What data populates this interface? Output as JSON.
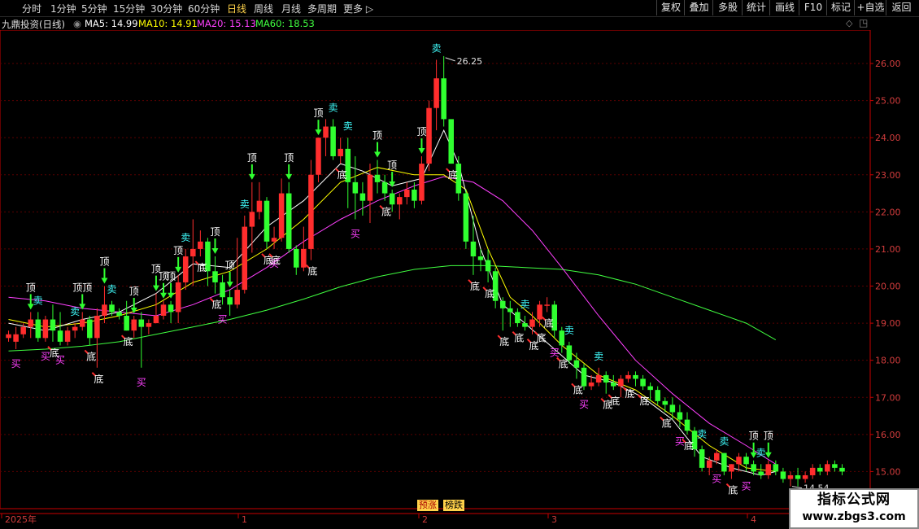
{
  "toolbar": {
    "periods": [
      "分时",
      "1分钟",
      "5分钟",
      "15分钟",
      "30分钟",
      "60分钟",
      "日线",
      "周线",
      "月线",
      "多周期",
      "更多 ▷"
    ],
    "active": "日线",
    "right_buttons": [
      "复权",
      "叠加",
      "多股",
      "统计",
      "画线",
      "F10",
      "标记",
      "+自选",
      "返回"
    ]
  },
  "legend": {
    "name": "九鼎投资(日线)",
    "ma5": "MA5: 14.99",
    "ma10": "MA10: 14.91",
    "ma20": "MA20: 15.13",
    "ma60": "MA60: 18.53"
  },
  "colors": {
    "up": "#ff2d2d",
    "down": "#30ff30",
    "ma5": "#ffffff",
    "ma10": "#ffff00",
    "ma20": "#ff40ff",
    "ma60": "#40ff40",
    "grid": "#5a0000",
    "axis": "#c80000",
    "sell": "#40ffff",
    "buy": "#ff40ff",
    "dtext": "#ffffff"
  },
  "badges": {
    "b1": "预涨",
    "b2": "榜跌"
  },
  "watermark": {
    "line1": "指标公式网",
    "line2": "www.zbgs3.com"
  },
  "chart_data": {
    "type": "candlestick",
    "ylim": [
      14.0,
      26.9
    ],
    "y_ticks": [
      "15.00",
      "16.00",
      "17.00",
      "18.00",
      "19.00",
      "20.00",
      "21.00",
      "22.00",
      "23.00",
      "24.00",
      "25.00",
      "26.00"
    ],
    "x_labels": [
      "2025年",
      "1",
      "2",
      "3",
      "4"
    ],
    "high_label": "26.25",
    "low_label": "14.54",
    "candles": [
      [
        18.6,
        18.7,
        18.5,
        18.8
      ],
      [
        18.5,
        18.7,
        18.3,
        18.9
      ],
      [
        18.7,
        18.9,
        18.6,
        19.0
      ],
      [
        18.9,
        19.1,
        18.6,
        19.3
      ],
      [
        19.1,
        18.6,
        18.5,
        19.3
      ],
      [
        18.6,
        19.1,
        18.5,
        19.2
      ],
      [
        19.1,
        18.8,
        18.5,
        19.5
      ],
      [
        18.8,
        18.5,
        18.4,
        19.3
      ],
      [
        18.5,
        18.8,
        18.4,
        18.9
      ],
      [
        18.8,
        18.9,
        18.6,
        19.0
      ],
      [
        18.9,
        19.1,
        18.8,
        19.3
      ],
      [
        19.1,
        18.6,
        18.4,
        19.2
      ],
      [
        18.6,
        19.2,
        17.8,
        19.4
      ],
      [
        19.2,
        19.5,
        19.0,
        20.0
      ],
      [
        19.5,
        19.3,
        19.2,
        19.6
      ],
      [
        19.3,
        19.2,
        19.1,
        19.4
      ],
      [
        19.2,
        18.8,
        18.8,
        19.6
      ],
      [
        18.8,
        19.1,
        18.6,
        19.2
      ],
      [
        19.1,
        18.9,
        17.8,
        19.3
      ],
      [
        18.9,
        19.0,
        18.7,
        19.1
      ],
      [
        19.0,
        19.2,
        19.0,
        19.8
      ],
      [
        19.2,
        19.5,
        19.1,
        19.6
      ],
      [
        19.5,
        19.3,
        19.0,
        19.6
      ],
      [
        19.3,
        20.1,
        19.0,
        20.3
      ],
      [
        20.1,
        20.8,
        19.9,
        21.0
      ],
      [
        20.8,
        21.0,
        20.0,
        21.8
      ],
      [
        21.0,
        21.2,
        20.8,
        21.5
      ],
      [
        21.2,
        20.4,
        20.0,
        21.3
      ],
      [
        20.4,
        20.1,
        19.8,
        20.8
      ],
      [
        20.1,
        19.7,
        19.5,
        20.3
      ],
      [
        19.7,
        19.5,
        19.2,
        19.9
      ],
      [
        19.5,
        19.9,
        19.4,
        21.3
      ],
      [
        19.9,
        21.6,
        19.8,
        21.9
      ],
      [
        21.6,
        22.0,
        20.9,
        22.8
      ],
      [
        22.0,
        22.3,
        21.8,
        22.8
      ],
      [
        22.3,
        21.2,
        21.0,
        22.4
      ],
      [
        21.2,
        21.3,
        21.0,
        21.6
      ],
      [
        21.3,
        22.5,
        21.2,
        22.9
      ],
      [
        22.5,
        21.0,
        20.9,
        22.8
      ],
      [
        21.0,
        20.5,
        20.3,
        21.1
      ],
      [
        20.5,
        21.0,
        20.4,
        21.6
      ],
      [
        21.0,
        23.0,
        20.7,
        23.4
      ],
      [
        23.0,
        24.0,
        22.8,
        24.0
      ],
      [
        24.0,
        24.3,
        23.5,
        24.5
      ],
      [
        24.3,
        23.5,
        23.4,
        24.5
      ],
      [
        23.5,
        23.7,
        23.3,
        24.0
      ],
      [
        23.7,
        22.8,
        22.1,
        24.0
      ],
      [
        22.8,
        22.5,
        21.8,
        23.5
      ],
      [
        22.5,
        22.3,
        21.9,
        22.8
      ],
      [
        22.3,
        23.0,
        21.7,
        23.3
      ],
      [
        23.0,
        22.8,
        22.5,
        23.4
      ],
      [
        22.8,
        22.5,
        22.3,
        23.0
      ],
      [
        22.5,
        22.2,
        22.0,
        22.6
      ],
      [
        22.2,
        22.4,
        21.8,
        22.5
      ],
      [
        22.4,
        22.6,
        22.2,
        22.8
      ],
      [
        22.6,
        22.3,
        22.1,
        22.8
      ],
      [
        22.3,
        23.3,
        22.2,
        23.5
      ],
      [
        23.3,
        24.8,
        23.1,
        25.0
      ],
      [
        24.8,
        25.6,
        24.2,
        26.1
      ],
      [
        25.6,
        24.5,
        24.3,
        26.2
      ],
      [
        24.5,
        23.3,
        23.3,
        24.0
      ],
      [
        23.3,
        22.5,
        22.3,
        23.5
      ],
      [
        22.5,
        21.2,
        21.0,
        22.6
      ],
      [
        21.2,
        20.8,
        20.3,
        21.9
      ],
      [
        20.8,
        20.7,
        20.4,
        21.0
      ],
      [
        20.7,
        20.4,
        20.1,
        21.0
      ],
      [
        20.4,
        19.6,
        19.4,
        20.5
      ],
      [
        19.6,
        19.4,
        18.8,
        19.7
      ],
      [
        19.4,
        19.3,
        18.9,
        19.6
      ],
      [
        19.3,
        19.0,
        18.9,
        19.4
      ],
      [
        19.0,
        18.9,
        18.8,
        19.2
      ],
      [
        18.9,
        19.1,
        18.7,
        19.3
      ],
      [
        19.1,
        19.5,
        18.9,
        19.6
      ],
      [
        19.5,
        19.5,
        19.3,
        19.7
      ],
      [
        19.5,
        18.8,
        18.6,
        19.6
      ],
      [
        18.8,
        18.4,
        18.2,
        18.9
      ],
      [
        18.4,
        18.0,
        17.9,
        18.5
      ],
      [
        18.0,
        17.8,
        17.5,
        18.2
      ],
      [
        17.8,
        17.3,
        17.2,
        17.9
      ],
      [
        17.3,
        17.4,
        17.2,
        17.6
      ],
      [
        17.4,
        17.6,
        17.3,
        17.8
      ],
      [
        17.6,
        17.4,
        17.1,
        17.7
      ],
      [
        17.4,
        17.3,
        17.2,
        17.6
      ],
      [
        17.3,
        17.5,
        17.0,
        17.6
      ],
      [
        17.5,
        17.6,
        17.4,
        17.7
      ],
      [
        17.6,
        17.5,
        17.3,
        17.7
      ],
      [
        17.5,
        17.3,
        17.2,
        17.6
      ],
      [
        17.3,
        17.2,
        16.9,
        17.4
      ],
      [
        17.2,
        16.9,
        16.8,
        17.3
      ],
      [
        16.9,
        16.8,
        16.6,
        17.0
      ],
      [
        16.8,
        16.6,
        16.4,
        17.0
      ],
      [
        16.6,
        16.4,
        16.2,
        16.8
      ],
      [
        16.4,
        16.1,
        16.0,
        16.6
      ],
      [
        16.1,
        15.6,
        15.4,
        16.2
      ],
      [
        15.6,
        15.1,
        15.0,
        15.7
      ],
      [
        15.1,
        15.3,
        14.9,
        15.4
      ],
      [
        15.3,
        15.5,
        15.2,
        15.6
      ],
      [
        15.5,
        15.0,
        14.9,
        15.5
      ],
      [
        15.0,
        15.2,
        14.8,
        15.2
      ],
      [
        15.2,
        15.4,
        15.0,
        15.5
      ],
      [
        15.4,
        15.2,
        15.0,
        15.5
      ],
      [
        15.2,
        15.0,
        14.9,
        15.3
      ],
      [
        15.0,
        14.9,
        14.8,
        15.2
      ],
      [
        14.9,
        15.2,
        14.8,
        15.3
      ],
      [
        15.2,
        15.0,
        14.9,
        15.3
      ],
      [
        15.0,
        14.8,
        14.7,
        15.1
      ],
      [
        14.8,
        14.9,
        14.6,
        15.0
      ],
      [
        14.9,
        14.8,
        14.6,
        15.1
      ],
      [
        14.8,
        14.9,
        14.7,
        15.0
      ],
      [
        14.9,
        15.1,
        14.8,
        15.2
      ],
      [
        15.1,
        15.0,
        14.9,
        15.2
      ],
      [
        15.0,
        15.2,
        14.9,
        15.3
      ],
      [
        15.2,
        15.1,
        15.0,
        15.3
      ],
      [
        15.1,
        15.0,
        14.9,
        15.2
      ]
    ],
    "ma60": [
      [
        0,
        18.25
      ],
      [
        5,
        18.3
      ],
      [
        10,
        18.38
      ],
      [
        15,
        18.5
      ],
      [
        20,
        18.7
      ],
      [
        25,
        18.9
      ],
      [
        30,
        19.1
      ],
      [
        35,
        19.35
      ],
      [
        40,
        19.65
      ],
      [
        45,
        19.98
      ],
      [
        50,
        20.25
      ],
      [
        55,
        20.45
      ],
      [
        60,
        20.55
      ],
      [
        65,
        20.55
      ],
      [
        70,
        20.5
      ],
      [
        75,
        20.45
      ],
      [
        80,
        20.3
      ],
      [
        85,
        20.05
      ],
      [
        90,
        19.7
      ],
      [
        95,
        19.35
      ],
      [
        100,
        19.0
      ],
      [
        104,
        18.55
      ]
    ],
    "ma20": [
      [
        0,
        19.7
      ],
      [
        5,
        19.6
      ],
      [
        10,
        19.4
      ],
      [
        15,
        19.3
      ],
      [
        20,
        19.2
      ],
      [
        25,
        19.5
      ],
      [
        30,
        19.9
      ],
      [
        35,
        20.5
      ],
      [
        40,
        21.2
      ],
      [
        45,
        21.8
      ],
      [
        50,
        22.3
      ],
      [
        55,
        22.7
      ],
      [
        59,
        22.95
      ],
      [
        63,
        22.8
      ],
      [
        67,
        22.3
      ],
      [
        71,
        21.5
      ],
      [
        75,
        20.5
      ],
      [
        80,
        19.2
      ],
      [
        85,
        18.0
      ],
      [
        90,
        17.1
      ],
      [
        95,
        16.3
      ],
      [
        100,
        15.7
      ],
      [
        104,
        15.2
      ]
    ],
    "ma10": [
      [
        0,
        19.1
      ],
      [
        5,
        18.9
      ],
      [
        10,
        19.0
      ],
      [
        15,
        19.2
      ],
      [
        20,
        19.5
      ],
      [
        25,
        20.1
      ],
      [
        30,
        20.4
      ],
      [
        35,
        21.0
      ],
      [
        40,
        21.8
      ],
      [
        45,
        22.8
      ],
      [
        50,
        23.2
      ],
      [
        55,
        23.0
      ],
      [
        59,
        23.0
      ],
      [
        62,
        22.6
      ],
      [
        65,
        21.0
      ],
      [
        68,
        19.7
      ],
      [
        71,
        19.2
      ],
      [
        75,
        18.4
      ],
      [
        80,
        17.6
      ],
      [
        85,
        17.2
      ],
      [
        90,
        16.5
      ],
      [
        95,
        15.7
      ],
      [
        100,
        15.1
      ],
      [
        104,
        15.0
      ]
    ],
    "ma5": [
      [
        0,
        19.0
      ],
      [
        5,
        18.8
      ],
      [
        10,
        19.1
      ],
      [
        15,
        19.3
      ],
      [
        20,
        19.8
      ],
      [
        25,
        20.6
      ],
      [
        30,
        20.5
      ],
      [
        35,
        21.6
      ],
      [
        40,
        22.3
      ],
      [
        45,
        23.3
      ],
      [
        48,
        23.1
      ],
      [
        52,
        22.7
      ],
      [
        56,
        22.9
      ],
      [
        59,
        24.2
      ],
      [
        61,
        23.3
      ],
      [
        64,
        21.0
      ],
      [
        67,
        19.5
      ],
      [
        70,
        19.0
      ],
      [
        74,
        18.3
      ],
      [
        78,
        17.6
      ],
      [
        82,
        17.4
      ],
      [
        86,
        17.0
      ],
      [
        90,
        16.4
      ],
      [
        94,
        15.4
      ],
      [
        98,
        15.1
      ],
      [
        102,
        14.9
      ],
      [
        104,
        15.0
      ]
    ]
  },
  "signals": [
    {
      "i": 3,
      "t": "顶",
      "type": "top"
    },
    {
      "i": 10,
      "t": "顶顶",
      "type": "top"
    },
    {
      "i": 13,
      "t": "顶",
      "type": "top"
    },
    {
      "i": 17,
      "t": "顶",
      "type": "top"
    },
    {
      "i": 20,
      "t": "顶",
      "type": "top"
    },
    {
      "i": 21,
      "t": "顶",
      "type": "top"
    },
    {
      "i": 22,
      "t": "顶",
      "type": "top"
    },
    {
      "i": 23,
      "t": "顶",
      "type": "top"
    },
    {
      "i": 28,
      "t": "顶",
      "type": "top"
    },
    {
      "i": 30,
      "t": "顶",
      "type": "top"
    },
    {
      "i": 33,
      "t": "顶",
      "type": "top"
    },
    {
      "i": 38,
      "t": "顶",
      "type": "top"
    },
    {
      "i": 42,
      "t": "顶",
      "type": "top"
    },
    {
      "i": 50,
      "t": "顶",
      "type": "top"
    },
    {
      "i": 52,
      "t": "顶",
      "type": "top"
    },
    {
      "i": 56,
      "t": "顶",
      "type": "top"
    },
    {
      "i": 1,
      "t": "买",
      "type": "buy"
    },
    {
      "i": 5,
      "t": "买",
      "type": "buy"
    },
    {
      "i": 7,
      "t": "买",
      "type": "buy"
    },
    {
      "i": 18,
      "t": "买",
      "type": "buy"
    },
    {
      "i": 29,
      "t": "买",
      "type": "buy"
    },
    {
      "i": 36,
      "t": "买",
      "type": "buy"
    },
    {
      "i": 47,
      "t": "买",
      "type": "buy"
    },
    {
      "i": 74,
      "t": "买",
      "type": "buy"
    },
    {
      "i": 78,
      "t": "买",
      "type": "buy"
    },
    {
      "i": 91,
      "t": "买",
      "type": "buy"
    },
    {
      "i": 96,
      "t": "买",
      "type": "buy"
    },
    {
      "i": 100,
      "t": "买",
      "type": "buy"
    },
    {
      "i": 4,
      "t": "卖",
      "type": "sell"
    },
    {
      "i": 9,
      "t": "卖",
      "type": "sell"
    },
    {
      "i": 14,
      "t": "卖",
      "type": "sell"
    },
    {
      "i": 24,
      "t": "卖",
      "type": "sell"
    },
    {
      "i": 32,
      "t": "卖",
      "type": "sell"
    },
    {
      "i": 44,
      "t": "卖",
      "type": "sell"
    },
    {
      "i": 46,
      "t": "卖",
      "type": "sell"
    },
    {
      "i": 58,
      "t": "卖",
      "type": "sell"
    },
    {
      "i": 70,
      "t": "卖",
      "type": "sell"
    },
    {
      "i": 76,
      "t": "卖",
      "type": "sell"
    },
    {
      "i": 80,
      "t": "卖",
      "type": "sell"
    },
    {
      "i": 94,
      "t": "卖",
      "type": "sell"
    },
    {
      "i": 97,
      "t": "卖",
      "type": "sell"
    },
    {
      "i": 102,
      "t": "卖",
      "type": "sell"
    },
    {
      "i": 6,
      "t": "底",
      "type": "bottom"
    },
    {
      "i": 11,
      "t": "底",
      "type": "bottom"
    },
    {
      "i": 12,
      "t": "底",
      "type": "bottom"
    },
    {
      "i": 16,
      "t": "底",
      "type": "bottom"
    },
    {
      "i": 26,
      "t": "底",
      "type": "bottom"
    },
    {
      "i": 28,
      "t": "底",
      "type": "bottom"
    },
    {
      "i": 35,
      "t": "底",
      "type": "bottom"
    },
    {
      "i": 36,
      "t": "底",
      "type": "bottom"
    },
    {
      "i": 41,
      "t": "底",
      "type": "bottom"
    },
    {
      "i": 45,
      "t": "底",
      "type": "bottom"
    },
    {
      "i": 51,
      "t": "底",
      "type": "bottom"
    },
    {
      "i": 60,
      "t": "底",
      "type": "bottom"
    },
    {
      "i": 63,
      "t": "底",
      "type": "bottom"
    },
    {
      "i": 65,
      "t": "底",
      "type": "bottom"
    },
    {
      "i": 67,
      "t": "底",
      "type": "bottom"
    },
    {
      "i": 69,
      "t": "底",
      "type": "bottom"
    },
    {
      "i": 71,
      "t": "底",
      "type": "bottom"
    },
    {
      "i": 72,
      "t": "底",
      "type": "bottom"
    },
    {
      "i": 73,
      "t": "底",
      "type": "bottom"
    },
    {
      "i": 75,
      "t": "底",
      "type": "bottom"
    },
    {
      "i": 77,
      "t": "底",
      "type": "bottom"
    },
    {
      "i": 81,
      "t": "底",
      "type": "bottom"
    },
    {
      "i": 82,
      "t": "底",
      "type": "bottom"
    },
    {
      "i": 84,
      "t": "底",
      "type": "bottom"
    },
    {
      "i": 86,
      "t": "底",
      "type": "bottom"
    },
    {
      "i": 89,
      "t": "底",
      "type": "bottom"
    },
    {
      "i": 92,
      "t": "底",
      "type": "bottom"
    },
    {
      "i": 98,
      "t": "底",
      "type": "bottom"
    },
    {
      "i": 101,
      "t": "顶",
      "type": "top"
    },
    {
      "i": 103,
      "t": "顶",
      "type": "top"
    }
  ]
}
